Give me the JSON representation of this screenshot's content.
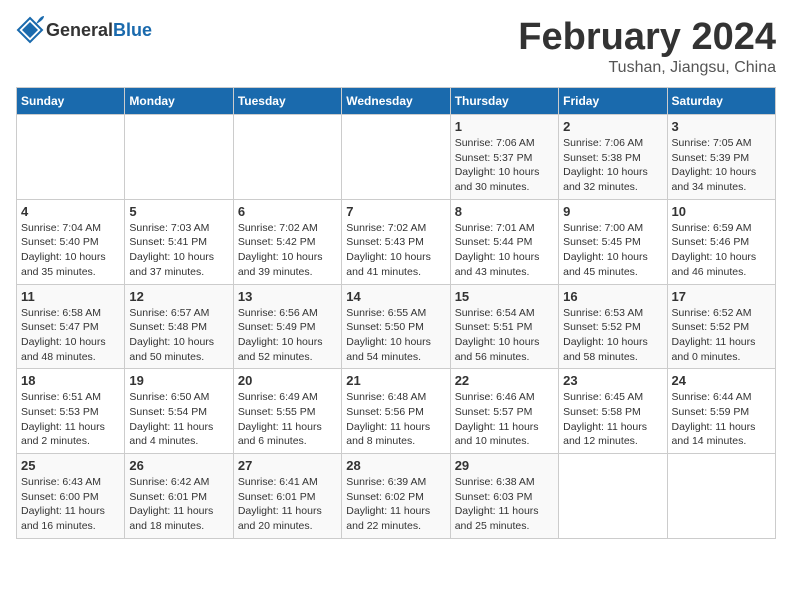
{
  "header": {
    "logo_general": "General",
    "logo_blue": "Blue",
    "month_title": "February 2024",
    "location": "Tushan, Jiangsu, China"
  },
  "days_of_week": [
    "Sunday",
    "Monday",
    "Tuesday",
    "Wednesday",
    "Thursday",
    "Friday",
    "Saturday"
  ],
  "weeks": [
    [
      null,
      null,
      null,
      null,
      {
        "day": "1",
        "sunrise": "7:06 AM",
        "sunset": "5:37 PM",
        "daylight": "10 hours and 30 minutes."
      },
      {
        "day": "2",
        "sunrise": "7:06 AM",
        "sunset": "5:38 PM",
        "daylight": "10 hours and 32 minutes."
      },
      {
        "day": "3",
        "sunrise": "7:05 AM",
        "sunset": "5:39 PM",
        "daylight": "10 hours and 34 minutes."
      }
    ],
    [
      {
        "day": "4",
        "sunrise": "7:04 AM",
        "sunset": "5:40 PM",
        "daylight": "10 hours and 35 minutes."
      },
      {
        "day": "5",
        "sunrise": "7:03 AM",
        "sunset": "5:41 PM",
        "daylight": "10 hours and 37 minutes."
      },
      {
        "day": "6",
        "sunrise": "7:02 AM",
        "sunset": "5:42 PM",
        "daylight": "10 hours and 39 minutes."
      },
      {
        "day": "7",
        "sunrise": "7:02 AM",
        "sunset": "5:43 PM",
        "daylight": "10 hours and 41 minutes."
      },
      {
        "day": "8",
        "sunrise": "7:01 AM",
        "sunset": "5:44 PM",
        "daylight": "10 hours and 43 minutes."
      },
      {
        "day": "9",
        "sunrise": "7:00 AM",
        "sunset": "5:45 PM",
        "daylight": "10 hours and 45 minutes."
      },
      {
        "day": "10",
        "sunrise": "6:59 AM",
        "sunset": "5:46 PM",
        "daylight": "10 hours and 46 minutes."
      }
    ],
    [
      {
        "day": "11",
        "sunrise": "6:58 AM",
        "sunset": "5:47 PM",
        "daylight": "10 hours and 48 minutes."
      },
      {
        "day": "12",
        "sunrise": "6:57 AM",
        "sunset": "5:48 PM",
        "daylight": "10 hours and 50 minutes."
      },
      {
        "day": "13",
        "sunrise": "6:56 AM",
        "sunset": "5:49 PM",
        "daylight": "10 hours and 52 minutes."
      },
      {
        "day": "14",
        "sunrise": "6:55 AM",
        "sunset": "5:50 PM",
        "daylight": "10 hours and 54 minutes."
      },
      {
        "day": "15",
        "sunrise": "6:54 AM",
        "sunset": "5:51 PM",
        "daylight": "10 hours and 56 minutes."
      },
      {
        "day": "16",
        "sunrise": "6:53 AM",
        "sunset": "5:52 PM",
        "daylight": "10 hours and 58 minutes."
      },
      {
        "day": "17",
        "sunrise": "6:52 AM",
        "sunset": "5:52 PM",
        "daylight": "11 hours and 0 minutes."
      }
    ],
    [
      {
        "day": "18",
        "sunrise": "6:51 AM",
        "sunset": "5:53 PM",
        "daylight": "11 hours and 2 minutes."
      },
      {
        "day": "19",
        "sunrise": "6:50 AM",
        "sunset": "5:54 PM",
        "daylight": "11 hours and 4 minutes."
      },
      {
        "day": "20",
        "sunrise": "6:49 AM",
        "sunset": "5:55 PM",
        "daylight": "11 hours and 6 minutes."
      },
      {
        "day": "21",
        "sunrise": "6:48 AM",
        "sunset": "5:56 PM",
        "daylight": "11 hours and 8 minutes."
      },
      {
        "day": "22",
        "sunrise": "6:46 AM",
        "sunset": "5:57 PM",
        "daylight": "11 hours and 10 minutes."
      },
      {
        "day": "23",
        "sunrise": "6:45 AM",
        "sunset": "5:58 PM",
        "daylight": "11 hours and 12 minutes."
      },
      {
        "day": "24",
        "sunrise": "6:44 AM",
        "sunset": "5:59 PM",
        "daylight": "11 hours and 14 minutes."
      }
    ],
    [
      {
        "day": "25",
        "sunrise": "6:43 AM",
        "sunset": "6:00 PM",
        "daylight": "11 hours and 16 minutes."
      },
      {
        "day": "26",
        "sunrise": "6:42 AM",
        "sunset": "6:01 PM",
        "daylight": "11 hours and 18 minutes."
      },
      {
        "day": "27",
        "sunrise": "6:41 AM",
        "sunset": "6:01 PM",
        "daylight": "11 hours and 20 minutes."
      },
      {
        "day": "28",
        "sunrise": "6:39 AM",
        "sunset": "6:02 PM",
        "daylight": "11 hours and 22 minutes."
      },
      {
        "day": "29",
        "sunrise": "6:38 AM",
        "sunset": "6:03 PM",
        "daylight": "11 hours and 25 minutes."
      },
      null,
      null
    ]
  ]
}
